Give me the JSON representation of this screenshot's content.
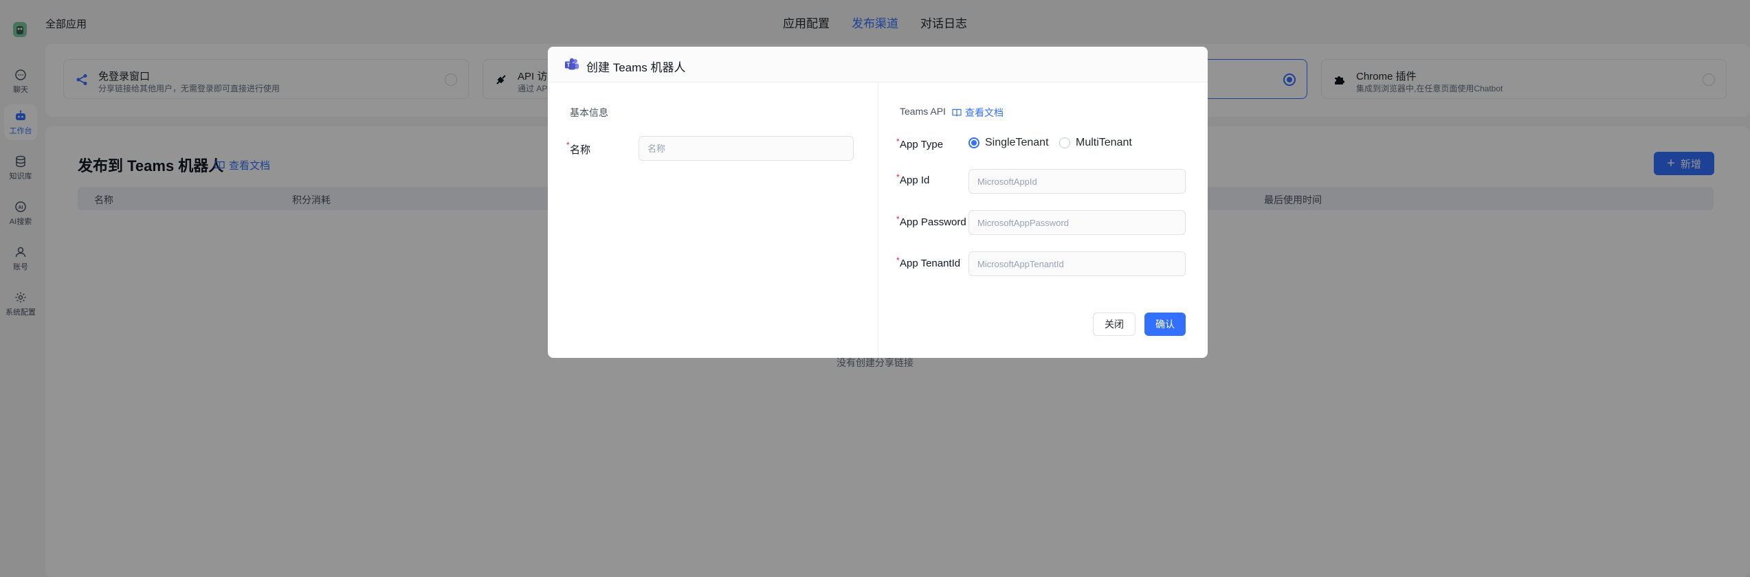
{
  "app": {
    "all_apps": "全部应用",
    "tabs": [
      "应用配置",
      "发布渠道",
      "对话日志"
    ],
    "active_tab": "发布渠道"
  },
  "sidebar": {
    "items": [
      {
        "label": "聊天",
        "icon": "chat-icon"
      },
      {
        "label": "工作台",
        "icon": "robot-icon",
        "active": true
      },
      {
        "label": "知识库",
        "icon": "database-icon"
      },
      {
        "label": "AI搜索",
        "icon": "ai-search-icon"
      },
      {
        "label": "账号",
        "icon": "user-icon"
      },
      {
        "label": "系统配置",
        "icon": "gear-icon"
      }
    ]
  },
  "channels": [
    {
      "title": "免登录窗口",
      "desc": "分享链接给其他用户，无需登录即可直接进行使用",
      "icon": "share-icon"
    },
    {
      "title": "API 访",
      "desc": "通过 AP",
      "icon": "api-icon"
    },
    {
      "title": "",
      "desc": "",
      "icon": "",
      "selected": true
    },
    {
      "title": "Chrome 插件",
      "desc": "集成到浏览器中,在任意页面使用Chatbot",
      "icon": "puzzle-icon"
    }
  ],
  "main": {
    "title": "发布到 Teams 机器人",
    "doc_link": "查看文档",
    "add_button": "新增",
    "table_headers": [
      "名称",
      "积分消耗",
      "最后使用时间"
    ],
    "empty_text": "没有创建分享链接"
  },
  "modal": {
    "title": "创建 Teams 机器人",
    "icon": "teams-icon",
    "left": {
      "section_title": "基本信息",
      "name_label": "名称",
      "name_placeholder": "名称",
      "name_value": ""
    },
    "right": {
      "section_title": "Teams API",
      "doc_link": "查看文档",
      "app_type_label": "App Type",
      "app_type_options": [
        "SingleTenant",
        "MultiTenant"
      ],
      "app_type_selected": "SingleTenant",
      "app_id_label": "App Id",
      "app_id_placeholder": "MicrosoftAppId",
      "app_password_label": "App Password",
      "app_password_placeholder": "MicrosoftAppPassword",
      "app_tenant_label": "App TenantId",
      "app_tenant_placeholder": "MicrosoftAppTenantId"
    },
    "buttons": {
      "close": "关闭",
      "confirm": "确认"
    }
  },
  "colors": {
    "accent": "#3370ff",
    "overlay": "rgba(0,0,0,0.42)",
    "required": "#e11d48"
  }
}
